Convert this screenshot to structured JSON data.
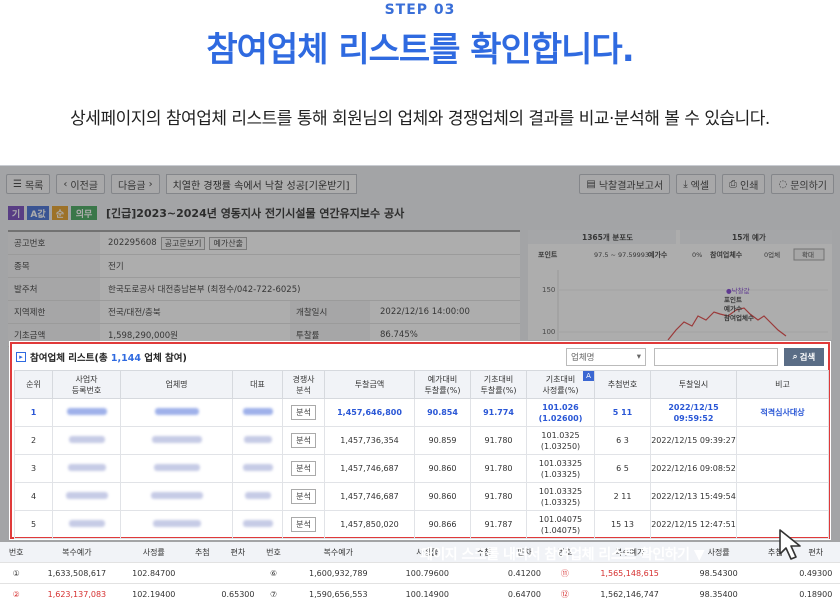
{
  "header": {
    "step": "STEP 03",
    "title": "참여업체 리스트를 확인합니다.",
    "subtitle": "상세페이지의 참여업체 리스트를 통해 회원님의 업체와 경쟁업체의 결과를 비교·분석해 볼 수 있습니다."
  },
  "toolbar": {
    "list": "목록",
    "prev": "이전글",
    "next": "다음글",
    "title": "치열한 경쟁률 속에서 낙찰 성공[기운받기]",
    "report": "낙찰결과보고서",
    "excel": "엑셀",
    "print": "인쇄",
    "inquiry": "문의하기"
  },
  "notice": {
    "tags": [
      {
        "label": "기",
        "color": "#6d3fb8"
      },
      {
        "label": "A값",
        "color": "#3a66d2"
      },
      {
        "label": "순",
        "color": "#e39a1a"
      },
      {
        "label": "의무",
        "color": "#3aa354"
      }
    ],
    "title": "[긴급]2023~2024년 영동지사 전기시설물 연간유지보수 공사"
  },
  "info": {
    "rows": [
      {
        "label": "공고번호",
        "value": "202295608",
        "btn1": "공고문보기",
        "btn2": "예가산출"
      },
      {
        "label": "종목",
        "value": "전기"
      },
      {
        "label": "발주처",
        "value": "한국도로공사 대전충남본부 (최정수/042-722-6025)"
      },
      {
        "label": "지역제한",
        "value": "전국/대전/충북",
        "label2": "개찰일시",
        "value2": "2022/12/16 14:00:00"
      },
      {
        "label": "기초금액",
        "value": "1,598,290,000원",
        "label2": "투찰률",
        "value2": "86.745%"
      }
    ]
  },
  "chart": {
    "head1": "1365개 분포도",
    "head2": "15개 예가",
    "sub_point": "포인트",
    "sub_range": "97.5 ~ 97.59993",
    "sub_count": "예가수",
    "sub_pct": "0%",
    "sub_bidders": "참여업체수",
    "sub_n": "0업체",
    "zoom": "확대",
    "y1": "150",
    "y2": "100",
    "legend_title": "●낙찰값",
    "legend_1": "포인트",
    "legend_2": "예가수",
    "legend_3": "참여업체수"
  },
  "panel": {
    "title_prefix": "참여업체 리스트(총 ",
    "total": "1,144",
    "title_suffix": " 업체 참여)",
    "select": "업체명",
    "search": "검색",
    "a_badge": "A",
    "columns": [
      "순위",
      "사업자\n등록번호",
      "업체명",
      "대표",
      "경쟁사\n분석",
      "투찰금액",
      "예가대비\n투찰률(%)",
      "기초대비\n투찰률(%)",
      "기초대비\n사정률(%)",
      "추첨번호",
      "투찰일시",
      "비고"
    ],
    "analyze": "분석",
    "rows": [
      {
        "rank": "1",
        "amount": "1,457,646,800",
        "r1": "90.854",
        "r2": "91.774",
        "r3a": "101.026",
        "r3b": "(1.02600)",
        "draw": "5 11",
        "dateA": "2022/12/15",
        "dateB": "09:59:52",
        "note": "적격심사대상",
        "hl": true
      },
      {
        "rank": "2",
        "amount": "1,457,736,354",
        "r1": "90.859",
        "r2": "91.780",
        "r3a": "101.0325",
        "r3b": "(1.03250)",
        "draw": "6 3",
        "dateA": "2022/12/15 09:39:27",
        "dateB": "",
        "note": "",
        "hl": false
      },
      {
        "rank": "3",
        "amount": "1,457,746,687",
        "r1": "90.860",
        "r2": "91.780",
        "r3a": "101.03325",
        "r3b": "(1.03325)",
        "draw": "6 5",
        "dateA": "2022/12/16 09:08:52",
        "dateB": "",
        "note": "",
        "hl": false
      },
      {
        "rank": "4",
        "amount": "1,457,746,687",
        "r1": "90.860",
        "r2": "91.780",
        "r3a": "101.03325",
        "r3b": "(1.03325)",
        "draw": "2 11",
        "dateA": "2022/12/13 15:49:54",
        "dateB": "",
        "note": "",
        "hl": false
      },
      {
        "rank": "5",
        "amount": "1,457,850,020",
        "r1": "90.866",
        "r2": "91.787",
        "r3a": "101.04075",
        "r3b": "(1.04075)",
        "draw": "15 13",
        "dateA": "2022/12/15 12:47:51",
        "dateB": "",
        "note": "",
        "hl": false
      }
    ]
  },
  "bottom": {
    "head": [
      "번호",
      "복수예가",
      "사정률",
      "추첨",
      "편차",
      "번호",
      "복수예가",
      "사정률",
      "추첨",
      "편차"
    ],
    "rows": [
      [
        "①",
        "1,633,508,617",
        "102.84700",
        "",
        "",
        "⑥",
        "1,600,932,789",
        "100.79600",
        "",
        "0.41200",
        "⑪",
        "1,565,148,615",
        "98.54300",
        "",
        "0.49300"
      ],
      [
        "②",
        "1,623,137,083",
        "102.19400",
        "",
        "0.65300",
        "⑦",
        "1,590,656,553",
        "100.14900",
        "",
        "0.64700",
        "⑫",
        "1,562,146,747",
        "98.35400",
        "",
        "0.18900"
      ]
    ]
  },
  "overlay": {
    "text": "페이지 스크롤 내려서 참여업체 리스트 확인하기 ▼"
  }
}
